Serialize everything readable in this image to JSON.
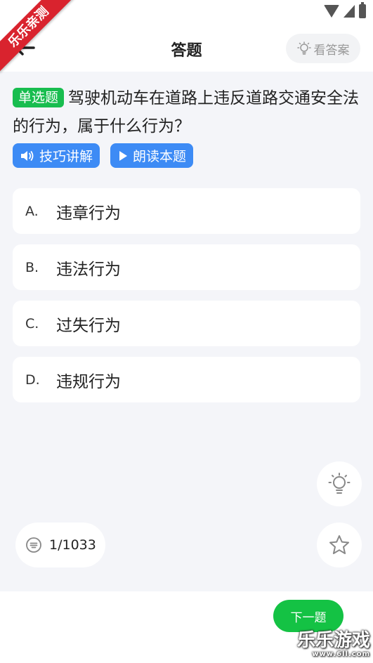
{
  "ribbon": {
    "text": "乐乐亲测"
  },
  "header": {
    "title": "答题",
    "answer_button_label": "看答案"
  },
  "question": {
    "type_badge": "单选题",
    "text": "驾驶机动车在道路上违反道路交通安全法的行为，属于什么行为？"
  },
  "tools": {
    "tips_label": "技巧讲解",
    "read_label": "朗读本题"
  },
  "options": [
    {
      "letter": "A.",
      "text": "违章行为"
    },
    {
      "letter": "B.",
      "text": "违法行为"
    },
    {
      "letter": "C.",
      "text": "过失行为"
    },
    {
      "letter": "D.",
      "text": "违规行为"
    }
  ],
  "progress": {
    "text": "1/1033"
  },
  "footer": {
    "next_label": "下一题"
  },
  "watermark": {
    "text": "乐乐游戏",
    "url": "www.6ll.com"
  },
  "colors": {
    "accent_green": "#18bd4f",
    "accent_blue": "#3d8bf5",
    "ribbon_red": "#d9232e"
  }
}
